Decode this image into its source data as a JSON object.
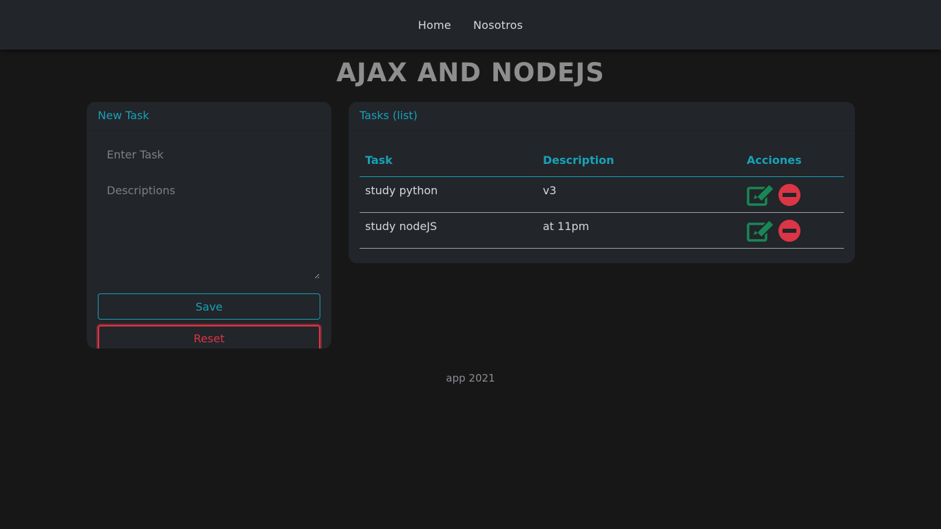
{
  "nav": {
    "items": [
      {
        "label": "Home"
      },
      {
        "label": "Nosotros"
      }
    ]
  },
  "page": {
    "title": "AJAX AND NODEJS"
  },
  "new_task": {
    "header": "New Task",
    "task_placeholder": "Enter Task",
    "task_value": "",
    "description_placeholder": "Descriptions",
    "description_value": "",
    "save_label": "Save",
    "reset_label": "Reset"
  },
  "tasks": {
    "header": "Tasks (list)",
    "columns": {
      "task": "Task",
      "description": "Description",
      "actions": "Acciones"
    },
    "rows": [
      {
        "task": "study python",
        "description": "v3"
      },
      {
        "task": "study nodeJS",
        "description": "at 11pm"
      }
    ]
  },
  "footer": {
    "text": "app 2021"
  },
  "colors": {
    "accent": "#17a2b8",
    "danger": "#dc3545",
    "edit_green": "#198754",
    "background": "#171718",
    "card": "#22252a"
  },
  "icons": {
    "edit": "edit-icon",
    "delete": "minus-circle-icon"
  }
}
